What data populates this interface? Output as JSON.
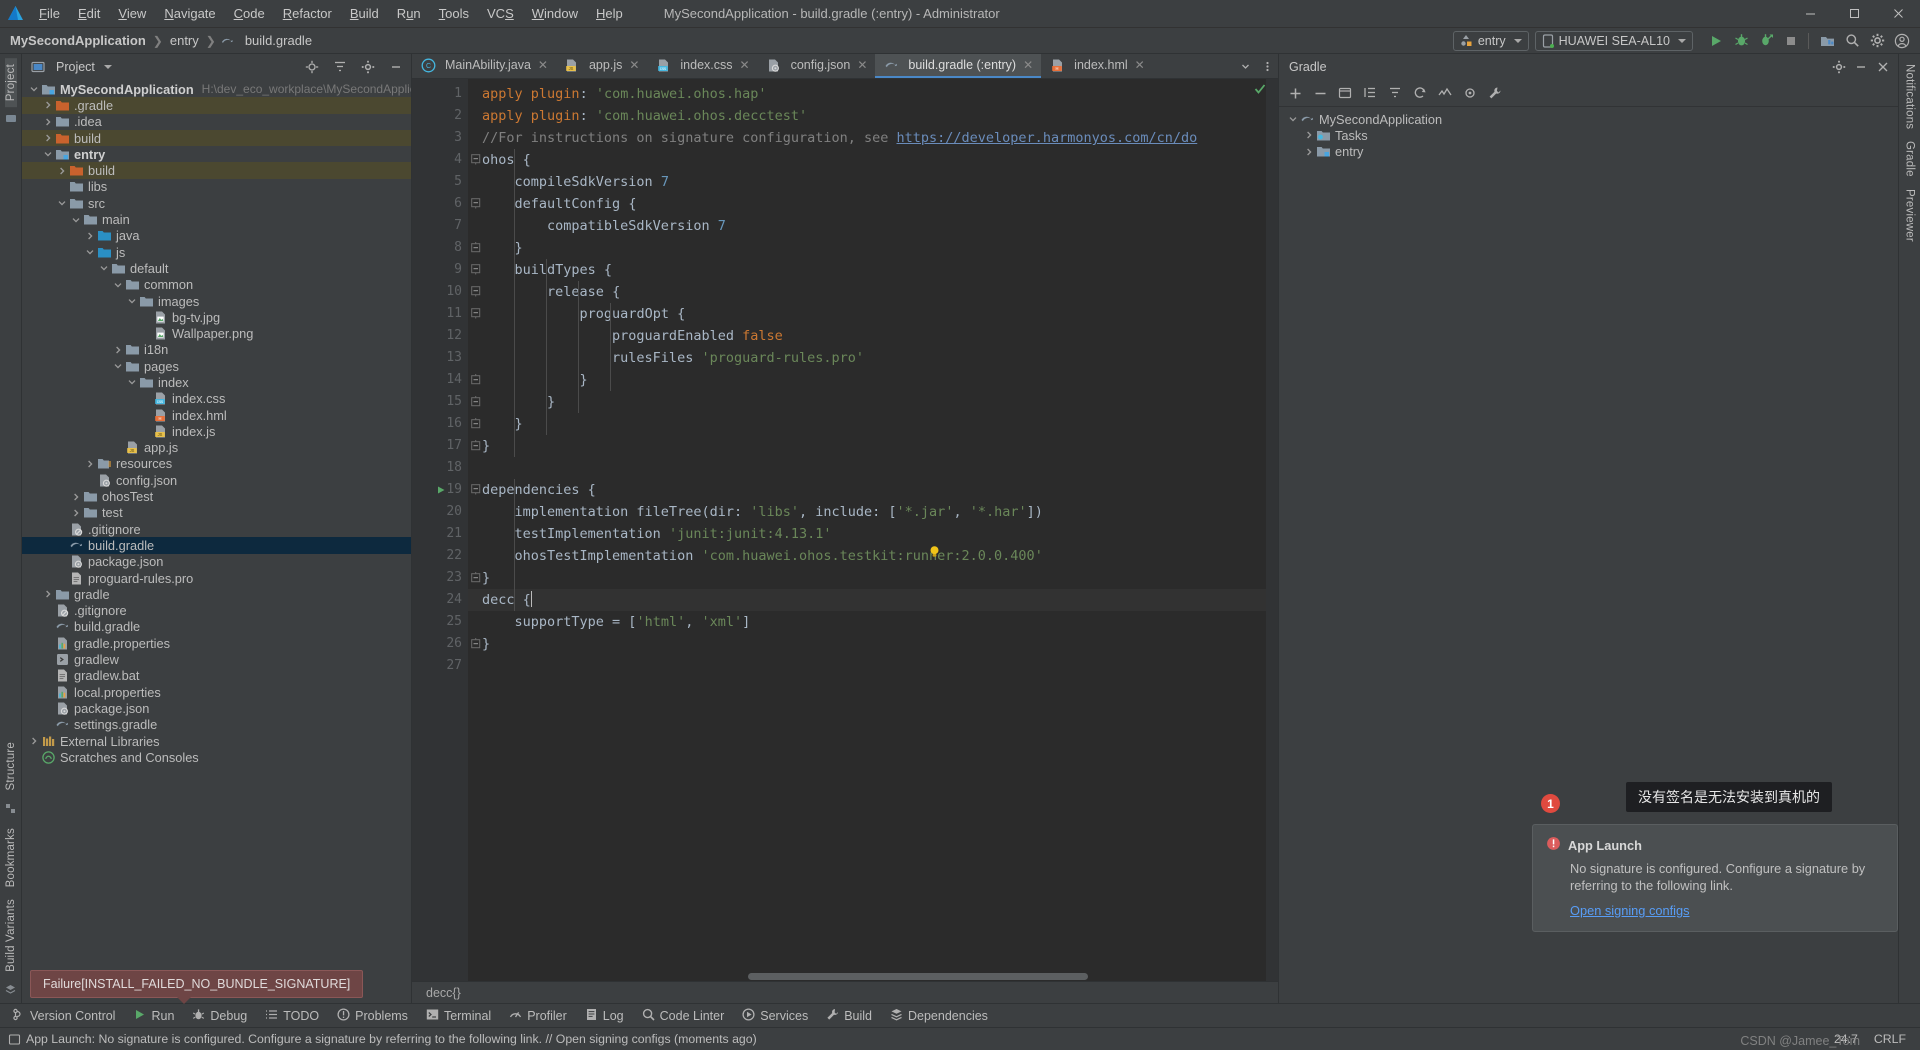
{
  "titlebar": {
    "menus": [
      "File",
      "Edit",
      "View",
      "Navigate",
      "Code",
      "Refactor",
      "Build",
      "Run",
      "Tools",
      "VCS",
      "Window",
      "Help"
    ],
    "window_title": "MySecondApplication - build.gradle (:entry) - Administrator",
    "minimize": "–",
    "maximize": "☐",
    "close": "✕"
  },
  "navbar": {
    "breadcrumbs": [
      "MySecondApplication",
      "entry",
      "build.gradle"
    ],
    "module_selector": "entry",
    "device_selector": "HUAWEI SEA-AL10",
    "icons": [
      "run-icon",
      "debug-icon",
      "profile-icon",
      "stop-icon",
      "device-manager-icon",
      "search-icon",
      "settings-icon",
      "account-icon"
    ]
  },
  "left_rail": {
    "top_label": "Project",
    "bottom_labels": [
      "Structure",
      "Bookmarks",
      "Build Variants"
    ]
  },
  "right_rail": {
    "labels": [
      "Notifications",
      "Gradle",
      "Previewer"
    ]
  },
  "project_panel": {
    "title": "Project",
    "root": "MySecondApplication",
    "root_path": "H:\\dev_eco_workplace\\MySecondApplication",
    "tree": [
      {
        "label": "MySecondApplication",
        "path": "H:\\dev_eco_workplace\\MySecondApplication",
        "indent": 0,
        "arrow": "down",
        "icon": "module-folder",
        "bold": true,
        "state": "normal"
      },
      {
        "label": ".gradle",
        "indent": 1,
        "arrow": "right",
        "icon": "excluded-folder",
        "state": "excluded"
      },
      {
        "label": ".idea",
        "indent": 1,
        "arrow": "right",
        "icon": "folder",
        "state": "normal"
      },
      {
        "label": "build",
        "indent": 1,
        "arrow": "right",
        "icon": "excluded-folder",
        "state": "excluded"
      },
      {
        "label": "entry",
        "indent": 1,
        "arrow": "down",
        "icon": "module-folder",
        "bold": true,
        "state": "normal"
      },
      {
        "label": "build",
        "indent": 2,
        "arrow": "right",
        "icon": "excluded-folder",
        "state": "excluded"
      },
      {
        "label": "libs",
        "indent": 2,
        "arrow": "none",
        "icon": "folder",
        "state": "normal"
      },
      {
        "label": "src",
        "indent": 2,
        "arrow": "down",
        "icon": "folder",
        "state": "normal"
      },
      {
        "label": "main",
        "indent": 3,
        "arrow": "down",
        "icon": "folder",
        "state": "normal"
      },
      {
        "label": "java",
        "indent": 4,
        "arrow": "right",
        "icon": "source-folder",
        "state": "normal"
      },
      {
        "label": "js",
        "indent": 4,
        "arrow": "down",
        "icon": "source-folder",
        "state": "normal"
      },
      {
        "label": "default",
        "indent": 5,
        "arrow": "down",
        "icon": "folder",
        "state": "normal"
      },
      {
        "label": "common",
        "indent": 6,
        "arrow": "down",
        "icon": "folder",
        "state": "normal"
      },
      {
        "label": "images",
        "indent": 7,
        "arrow": "down",
        "icon": "folder",
        "state": "normal"
      },
      {
        "label": "bg-tv.jpg",
        "indent": 8,
        "arrow": "none",
        "icon": "image-file",
        "state": "normal"
      },
      {
        "label": "Wallpaper.png",
        "indent": 8,
        "arrow": "none",
        "icon": "image-file",
        "state": "normal"
      },
      {
        "label": "i18n",
        "indent": 6,
        "arrow": "right",
        "icon": "folder",
        "state": "normal"
      },
      {
        "label": "pages",
        "indent": 6,
        "arrow": "down",
        "icon": "folder",
        "state": "normal"
      },
      {
        "label": "index",
        "indent": 7,
        "arrow": "down",
        "icon": "folder",
        "state": "normal"
      },
      {
        "label": "index.css",
        "indent": 8,
        "arrow": "none",
        "icon": "css-file",
        "state": "normal"
      },
      {
        "label": "index.hml",
        "indent": 8,
        "arrow": "none",
        "icon": "hml-file",
        "state": "normal"
      },
      {
        "label": "index.js",
        "indent": 8,
        "arrow": "none",
        "icon": "js-file",
        "state": "normal"
      },
      {
        "label": "app.js",
        "indent": 6,
        "arrow": "none",
        "icon": "js-file",
        "state": "normal"
      },
      {
        "label": "resources",
        "indent": 4,
        "arrow": "right",
        "icon": "resource-folder",
        "state": "normal"
      },
      {
        "label": "config.json",
        "indent": 4,
        "arrow": "none",
        "icon": "config-file",
        "state": "normal"
      },
      {
        "label": "ohosTest",
        "indent": 3,
        "arrow": "right",
        "icon": "folder",
        "state": "normal"
      },
      {
        "label": "test",
        "indent": 3,
        "arrow": "right",
        "icon": "folder",
        "state": "normal"
      },
      {
        "label": ".gitignore",
        "indent": 2,
        "arrow": "none",
        "icon": "gitignore-file",
        "state": "normal"
      },
      {
        "label": "build.gradle",
        "indent": 2,
        "arrow": "none",
        "icon": "gradle-file",
        "state": "selected"
      },
      {
        "label": "package.json",
        "indent": 2,
        "arrow": "none",
        "icon": "config-file",
        "state": "normal"
      },
      {
        "label": "proguard-rules.pro",
        "indent": 2,
        "arrow": "none",
        "icon": "text-file",
        "state": "normal"
      },
      {
        "label": "gradle",
        "indent": 1,
        "arrow": "right",
        "icon": "folder",
        "state": "normal"
      },
      {
        "label": ".gitignore",
        "indent": 1,
        "arrow": "none",
        "icon": "gitignore-file",
        "state": "normal"
      },
      {
        "label": "build.gradle",
        "indent": 1,
        "arrow": "none",
        "icon": "gradle-file",
        "state": "normal"
      },
      {
        "label": "gradle.properties",
        "indent": 1,
        "arrow": "none",
        "icon": "properties-file",
        "state": "normal"
      },
      {
        "label": "gradlew",
        "indent": 1,
        "arrow": "none",
        "icon": "script-file",
        "state": "normal"
      },
      {
        "label": "gradlew.bat",
        "indent": 1,
        "arrow": "none",
        "icon": "text-file",
        "state": "normal"
      },
      {
        "label": "local.properties",
        "indent": 1,
        "arrow": "none",
        "icon": "properties-file",
        "state": "normal"
      },
      {
        "label": "package.json",
        "indent": 1,
        "arrow": "none",
        "icon": "config-file",
        "state": "normal"
      },
      {
        "label": "settings.gradle",
        "indent": 1,
        "arrow": "none",
        "icon": "gradle-file",
        "state": "normal"
      },
      {
        "label": "External Libraries",
        "indent": 0,
        "arrow": "right",
        "icon": "library-icon",
        "state": "normal"
      },
      {
        "label": "Scratches and Consoles",
        "indent": 0,
        "arrow": "none",
        "icon": "scratches-icon",
        "state": "normal"
      }
    ]
  },
  "editor": {
    "tabs": [
      {
        "label": "MainAbility.java",
        "icon": "java-file",
        "active": false
      },
      {
        "label": "app.js",
        "icon": "js-file",
        "active": false
      },
      {
        "label": "index.css",
        "icon": "css-file",
        "active": false
      },
      {
        "label": "config.json",
        "icon": "config-file",
        "active": false
      },
      {
        "label": "build.gradle (:entry)",
        "icon": "gradle-file",
        "active": true
      },
      {
        "label": "index.hml",
        "icon": "hml-file",
        "active": false
      }
    ],
    "breadcrumb": "decc{}",
    "lines": [
      {
        "n": 1,
        "fold": "none"
      },
      {
        "n": 2,
        "fold": "none"
      },
      {
        "n": 3,
        "fold": "none"
      },
      {
        "n": 4,
        "fold": "open"
      },
      {
        "n": 5,
        "fold": "none"
      },
      {
        "n": 6,
        "fold": "open"
      },
      {
        "n": 7,
        "fold": "none"
      },
      {
        "n": 8,
        "fold": "close"
      },
      {
        "n": 9,
        "fold": "open"
      },
      {
        "n": 10,
        "fold": "open"
      },
      {
        "n": 11,
        "fold": "open"
      },
      {
        "n": 12,
        "fold": "none"
      },
      {
        "n": 13,
        "fold": "none"
      },
      {
        "n": 14,
        "fold": "close"
      },
      {
        "n": 15,
        "fold": "close"
      },
      {
        "n": 16,
        "fold": "close"
      },
      {
        "n": 17,
        "fold": "close"
      },
      {
        "n": 18,
        "fold": "none"
      },
      {
        "n": 19,
        "fold": "open",
        "run": true
      },
      {
        "n": 20,
        "fold": "none"
      },
      {
        "n": 21,
        "fold": "none"
      },
      {
        "n": 22,
        "fold": "none"
      },
      {
        "n": 23,
        "fold": "close"
      },
      {
        "n": 24,
        "fold": "open"
      },
      {
        "n": 25,
        "fold": "none"
      },
      {
        "n": 26,
        "fold": "close"
      },
      {
        "n": 27,
        "fold": "none"
      }
    ],
    "source_text": [
      "apply plugin: 'com.huawei.ohos.hap'",
      "apply plugin: 'com.huawei.ohos.decctest'",
      "//For instructions on signature configuration, see https://developer.harmonyos.com/cn/do",
      "ohos {",
      "    compileSdkVersion 7",
      "    defaultConfig {",
      "        compatibleSdkVersion 7",
      "    }",
      "    buildTypes {",
      "        release {",
      "            proguardOpt {",
      "                proguardEnabled false",
      "                rulesFiles 'proguard-rules.pro'",
      "            }",
      "        }",
      "    }",
      "}",
      "",
      "dependencies {",
      "    implementation fileTree(dir: 'libs', include: ['*.jar', '*.har'])",
      "    testImplementation 'junit:junit:4.13.1'",
      "    ohosTestImplementation 'com.huawei.ohos.testkit:runner:2.0.0.400'",
      "}",
      "decc {",
      "    supportType = ['html', 'xml']",
      "}",
      ""
    ]
  },
  "gradle_panel": {
    "title": "Gradle",
    "tree": [
      {
        "label": "MySecondApplication",
        "indent": 0,
        "arrow": "down",
        "icon": "gradle-project"
      },
      {
        "label": "Tasks",
        "indent": 1,
        "arrow": "right",
        "icon": "tasks-folder"
      },
      {
        "label": "entry",
        "indent": 1,
        "arrow": "right",
        "icon": "gradle-module"
      }
    ],
    "toolbar_icons": [
      "add-icon",
      "remove-icon",
      "execute-task-icon",
      "expand-all-icon",
      "collapse-all-icon",
      "sync-icon",
      "toggle-offline-icon",
      "filter-icon",
      "build-tool-icon"
    ]
  },
  "notifications": {
    "tooltip_text": "没有签名是无法安装到真机的",
    "badge_count": "1",
    "balloon_title": "App Launch",
    "balloon_body": "No signature is configured. Configure a signature by referring to the following link.",
    "balloon_link": "Open signing configs"
  },
  "run_tooltip": "Failure[INSTALL_FAILED_NO_BUNDLE_SIGNATURE]",
  "toolwindows": [
    {
      "label": "Version Control",
      "icon": "branch-icon"
    },
    {
      "label": "Run",
      "icon": "run-icon"
    },
    {
      "label": "Debug",
      "icon": "debug-icon"
    },
    {
      "label": "TODO",
      "icon": "todo-icon"
    },
    {
      "label": "Problems",
      "icon": "problems-icon"
    },
    {
      "label": "Terminal",
      "icon": "terminal-icon"
    },
    {
      "label": "Profiler",
      "icon": "profiler-icon"
    },
    {
      "label": "Log",
      "icon": "log-icon"
    },
    {
      "label": "Code Linter",
      "icon": "linter-icon"
    },
    {
      "label": "Services",
      "icon": "services-icon"
    },
    {
      "label": "Build",
      "icon": "build-icon"
    },
    {
      "label": "Dependencies",
      "icon": "dependencies-icon"
    }
  ],
  "statusbar": {
    "message": "App Launch: No signature is configured. Configure a signature by referring to the following link. // Open signing configs (moments ago)",
    "caret_position": "24:7",
    "line_separator": "CRLF",
    "watermark": "CSDN @Jamee_Tom"
  },
  "colors": {
    "accent": "#4a88c7",
    "error": "#e04a3f",
    "link": "#589df6",
    "selection": "#0d293e",
    "excluded": "#4b4830",
    "editor_bg": "#2b2b2b",
    "panel_bg": "#3c3f41"
  }
}
